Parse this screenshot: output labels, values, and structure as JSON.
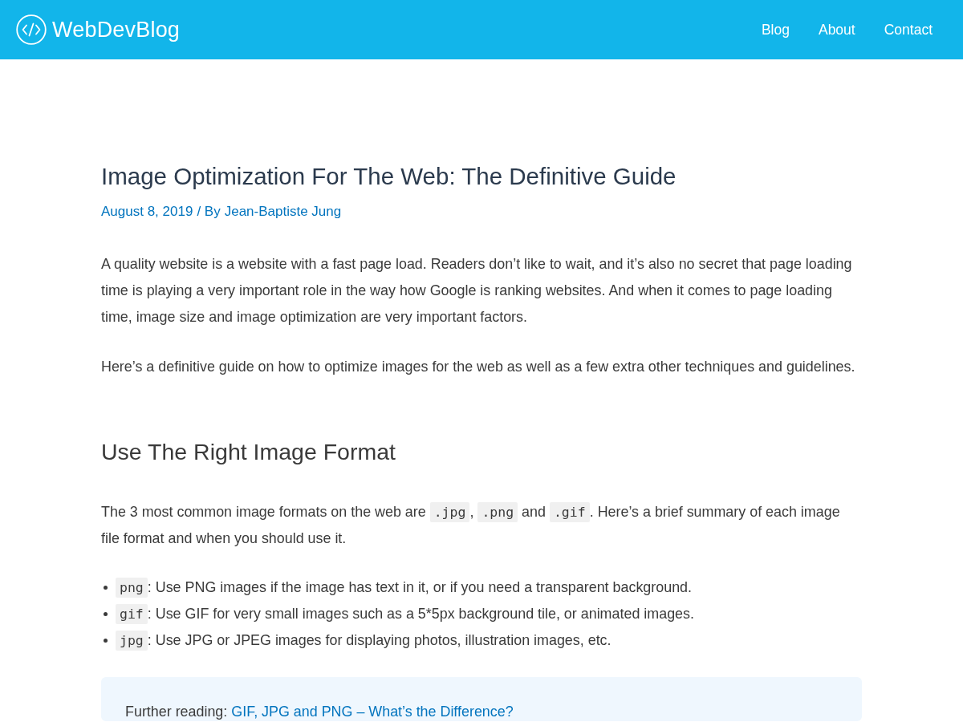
{
  "header": {
    "site_name": "WebDevBlog",
    "nav": [
      {
        "label": "Blog"
      },
      {
        "label": "About"
      },
      {
        "label": "Contact"
      }
    ]
  },
  "article": {
    "title": "Image Optimization For The Web: The Definitive Guide",
    "meta": {
      "date": "August 8, 2019",
      "separator": "/ By",
      "author": "Jean-Baptiste Jung"
    },
    "intro": [
      "A quality website is a website with a fast page load. Readers don’t like to wait, and it’s also no secret that page loading time is playing a very important role in the way how Google is ranking websites. And when it comes to page loading time, image size and image optimization are very important factors.",
      "Here’s a definitive guide on how to optimize images for the web as well as a few extra other techniques and guidelines."
    ],
    "sections": [
      {
        "heading": "Use The Right Image Format",
        "paragraph": [
          {
            "kind": "text",
            "text": "The 3 most common image formats on the web are "
          },
          {
            "kind": "code",
            "text": ".jpg"
          },
          {
            "kind": "text",
            "text": ", "
          },
          {
            "kind": "code",
            "text": ".png"
          },
          {
            "kind": "text",
            "text": " and "
          },
          {
            "kind": "code",
            "text": ".gif"
          },
          {
            "kind": "text",
            "text": ". Here’s a brief summary of each image file format and when you should use it."
          }
        ],
        "list": [
          {
            "code": "png",
            "text": ": Use PNG images if the image has text in it, or if you need a transparent background."
          },
          {
            "code": "gif",
            "text": ": Use GIF for very small images such as a 5*5px background tile, or animated images."
          },
          {
            "code": "jpg",
            "text": ": Use JPG or JPEG images for displaying photos, illustration images, etc."
          }
        ],
        "further_reading": {
          "label": "Further reading:",
          "link": "GIF, JPG and PNG – What’s the Difference?"
        }
      }
    ]
  }
}
